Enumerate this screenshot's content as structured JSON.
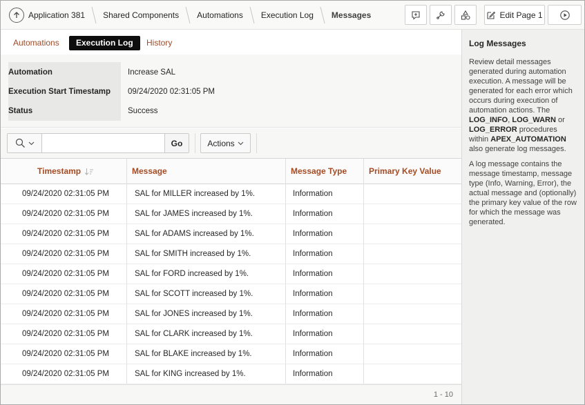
{
  "header": {
    "breadcrumbs": [
      "Application 381",
      "Shared Components",
      "Automations",
      "Execution Log",
      "Messages"
    ],
    "edit_page_label": "Edit Page 1"
  },
  "tabs": [
    {
      "label": "Automations",
      "active": false
    },
    {
      "label": "Execution Log",
      "active": true
    },
    {
      "label": "History",
      "active": false
    }
  ],
  "info": {
    "rows": [
      {
        "label": "Automation",
        "value": "Increase SAL"
      },
      {
        "label": "Execution Start Timestamp",
        "value": "09/24/2020 02:31:05 PM"
      },
      {
        "label": "Status",
        "value": "Success"
      }
    ]
  },
  "toolbar": {
    "search_value": "",
    "go_label": "Go",
    "actions_label": "Actions"
  },
  "grid": {
    "columns": [
      "Timestamp",
      "Message",
      "Message Type",
      "Primary Key Value"
    ],
    "rows": [
      {
        "timestamp": "09/24/2020 02:31:05 PM",
        "message": "SAL for MILLER increased by 1%.",
        "type": "Information",
        "pk": ""
      },
      {
        "timestamp": "09/24/2020 02:31:05 PM",
        "message": "SAL for JAMES increased by 1%.",
        "type": "Information",
        "pk": ""
      },
      {
        "timestamp": "09/24/2020 02:31:05 PM",
        "message": "SAL for ADAMS increased by 1%.",
        "type": "Information",
        "pk": ""
      },
      {
        "timestamp": "09/24/2020 02:31:05 PM",
        "message": "SAL for SMITH increased by 1%.",
        "type": "Information",
        "pk": ""
      },
      {
        "timestamp": "09/24/2020 02:31:05 PM",
        "message": "SAL for FORD increased by 1%.",
        "type": "Information",
        "pk": ""
      },
      {
        "timestamp": "09/24/2020 02:31:05 PM",
        "message": "SAL for SCOTT increased by 1%.",
        "type": "Information",
        "pk": ""
      },
      {
        "timestamp": "09/24/2020 02:31:05 PM",
        "message": "SAL for JONES increased by 1%.",
        "type": "Information",
        "pk": ""
      },
      {
        "timestamp": "09/24/2020 02:31:05 PM",
        "message": "SAL for CLARK increased by 1%.",
        "type": "Information",
        "pk": ""
      },
      {
        "timestamp": "09/24/2020 02:31:05 PM",
        "message": "SAL for BLAKE increased by 1%.",
        "type": "Information",
        "pk": ""
      },
      {
        "timestamp": "09/24/2020 02:31:05 PM",
        "message": "SAL for KING increased by 1%.",
        "type": "Information",
        "pk": ""
      }
    ],
    "pagination": "1 - 10"
  },
  "side_panel": {
    "title": "Log Messages",
    "p1_a": "Review detail messages generated during automation execution. A message will be generated for each error which occurs during execution of automation actions. The ",
    "p1_b1": "LOG_INFO",
    "p1_c": ", ",
    "p1_b2": "LOG_WARN",
    "p1_d": " or ",
    "p1_b3": "LOG_ERROR",
    "p1_e": " procedures within ",
    "p1_b4": "APEX_AUTOMATION",
    "p1_f": " also generate log messages.",
    "p2": "A log message contains the message timestamp, message type (Info, Warning, Error), the actual message and (optionally) the primary key value of the row for which the message was generated."
  },
  "colors": {
    "link": "#9b4b2a",
    "header_text": "#a54b23",
    "active_tab_bg": "#0d0d0d",
    "side_bg": "#f0f0ee"
  },
  "icons": [
    "up-arrow-icon",
    "comment-plus-icon",
    "wrench-icon",
    "shapes-icon",
    "edit-icon",
    "play-icon",
    "search-icon",
    "chevron-down-icon",
    "sort-desc-icon"
  ]
}
